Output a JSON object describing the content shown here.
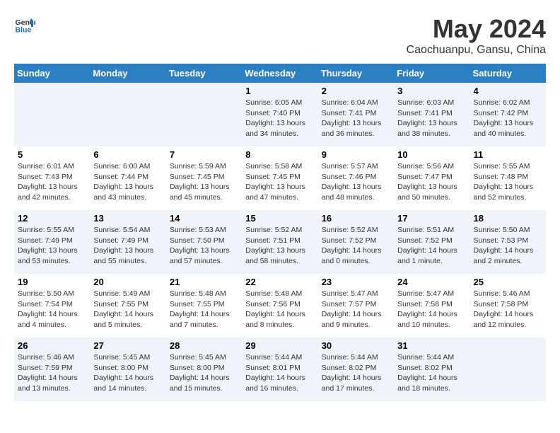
{
  "header": {
    "logo_general": "General",
    "logo_blue": "Blue",
    "month_year": "May 2024",
    "location": "Caochuanpu, Gansu, China"
  },
  "weekdays": [
    "Sunday",
    "Monday",
    "Tuesday",
    "Wednesday",
    "Thursday",
    "Friday",
    "Saturday"
  ],
  "weeks": [
    [
      {
        "day": "",
        "detail": ""
      },
      {
        "day": "",
        "detail": ""
      },
      {
        "day": "",
        "detail": ""
      },
      {
        "day": "1",
        "detail": "Sunrise: 6:05 AM\nSunset: 7:40 PM\nDaylight: 13 hours\nand 34 minutes."
      },
      {
        "day": "2",
        "detail": "Sunrise: 6:04 AM\nSunset: 7:41 PM\nDaylight: 13 hours\nand 36 minutes."
      },
      {
        "day": "3",
        "detail": "Sunrise: 6:03 AM\nSunset: 7:41 PM\nDaylight: 13 hours\nand 38 minutes."
      },
      {
        "day": "4",
        "detail": "Sunrise: 6:02 AM\nSunset: 7:42 PM\nDaylight: 13 hours\nand 40 minutes."
      }
    ],
    [
      {
        "day": "5",
        "detail": "Sunrise: 6:01 AM\nSunset: 7:43 PM\nDaylight: 13 hours\nand 42 minutes."
      },
      {
        "day": "6",
        "detail": "Sunrise: 6:00 AM\nSunset: 7:44 PM\nDaylight: 13 hours\nand 43 minutes."
      },
      {
        "day": "7",
        "detail": "Sunrise: 5:59 AM\nSunset: 7:45 PM\nDaylight: 13 hours\nand 45 minutes."
      },
      {
        "day": "8",
        "detail": "Sunrise: 5:58 AM\nSunset: 7:45 PM\nDaylight: 13 hours\nand 47 minutes."
      },
      {
        "day": "9",
        "detail": "Sunrise: 5:57 AM\nSunset: 7:46 PM\nDaylight: 13 hours\nand 48 minutes."
      },
      {
        "day": "10",
        "detail": "Sunrise: 5:56 AM\nSunset: 7:47 PM\nDaylight: 13 hours\nand 50 minutes."
      },
      {
        "day": "11",
        "detail": "Sunrise: 5:55 AM\nSunset: 7:48 PM\nDaylight: 13 hours\nand 52 minutes."
      }
    ],
    [
      {
        "day": "12",
        "detail": "Sunrise: 5:55 AM\nSunset: 7:49 PM\nDaylight: 13 hours\nand 53 minutes."
      },
      {
        "day": "13",
        "detail": "Sunrise: 5:54 AM\nSunset: 7:49 PM\nDaylight: 13 hours\nand 55 minutes."
      },
      {
        "day": "14",
        "detail": "Sunrise: 5:53 AM\nSunset: 7:50 PM\nDaylight: 13 hours\nand 57 minutes."
      },
      {
        "day": "15",
        "detail": "Sunrise: 5:52 AM\nSunset: 7:51 PM\nDaylight: 13 hours\nand 58 minutes."
      },
      {
        "day": "16",
        "detail": "Sunrise: 5:52 AM\nSunset: 7:52 PM\nDaylight: 14 hours\nand 0 minutes."
      },
      {
        "day": "17",
        "detail": "Sunrise: 5:51 AM\nSunset: 7:52 PM\nDaylight: 14 hours\nand 1 minute."
      },
      {
        "day": "18",
        "detail": "Sunrise: 5:50 AM\nSunset: 7:53 PM\nDaylight: 14 hours\nand 2 minutes."
      }
    ],
    [
      {
        "day": "19",
        "detail": "Sunrise: 5:50 AM\nSunset: 7:54 PM\nDaylight: 14 hours\nand 4 minutes."
      },
      {
        "day": "20",
        "detail": "Sunrise: 5:49 AM\nSunset: 7:55 PM\nDaylight: 14 hours\nand 5 minutes."
      },
      {
        "day": "21",
        "detail": "Sunrise: 5:48 AM\nSunset: 7:55 PM\nDaylight: 14 hours\nand 7 minutes."
      },
      {
        "day": "22",
        "detail": "Sunrise: 5:48 AM\nSunset: 7:56 PM\nDaylight: 14 hours\nand 8 minutes."
      },
      {
        "day": "23",
        "detail": "Sunrise: 5:47 AM\nSunset: 7:57 PM\nDaylight: 14 hours\nand 9 minutes."
      },
      {
        "day": "24",
        "detail": "Sunrise: 5:47 AM\nSunset: 7:58 PM\nDaylight: 14 hours\nand 10 minutes."
      },
      {
        "day": "25",
        "detail": "Sunrise: 5:46 AM\nSunset: 7:58 PM\nDaylight: 14 hours\nand 12 minutes."
      }
    ],
    [
      {
        "day": "26",
        "detail": "Sunrise: 5:46 AM\nSunset: 7:59 PM\nDaylight: 14 hours\nand 13 minutes."
      },
      {
        "day": "27",
        "detail": "Sunrise: 5:45 AM\nSunset: 8:00 PM\nDaylight: 14 hours\nand 14 minutes."
      },
      {
        "day": "28",
        "detail": "Sunrise: 5:45 AM\nSunset: 8:00 PM\nDaylight: 14 hours\nand 15 minutes."
      },
      {
        "day": "29",
        "detail": "Sunrise: 5:44 AM\nSunset: 8:01 PM\nDaylight: 14 hours\nand 16 minutes."
      },
      {
        "day": "30",
        "detail": "Sunrise: 5:44 AM\nSunset: 8:02 PM\nDaylight: 14 hours\nand 17 minutes."
      },
      {
        "day": "31",
        "detail": "Sunrise: 5:44 AM\nSunset: 8:02 PM\nDaylight: 14 hours\nand 18 minutes."
      },
      {
        "day": "",
        "detail": ""
      }
    ]
  ]
}
